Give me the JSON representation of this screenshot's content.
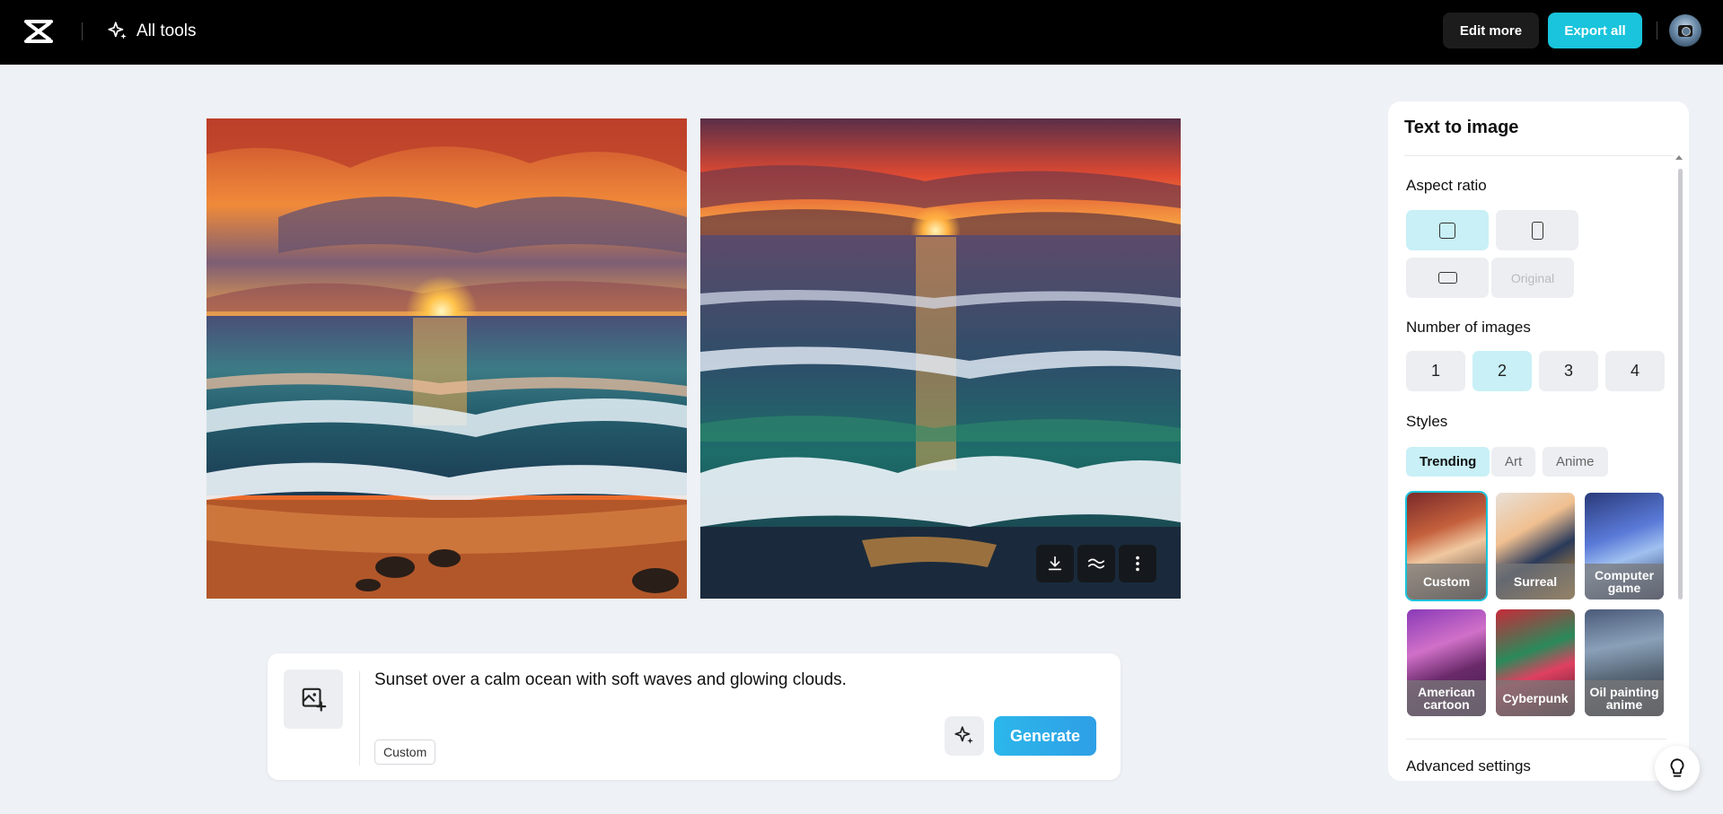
{
  "header": {
    "logo": "capcut-logo",
    "all_tools_label": "All tools",
    "edit_more_label": "Edit more",
    "export_all_label": "Export all"
  },
  "images": [
    {
      "subject": "Sunset over ocean with waves on rocky beach"
    },
    {
      "subject": "Sunset over ocean with breaking waves"
    }
  ],
  "image_toolbar": {
    "icons": [
      "download-icon",
      "upscale-icon",
      "more-icon"
    ]
  },
  "prompt": {
    "text": "Sunset over a calm ocean with soft waves and glowing clouds.",
    "style_chip": "Custom",
    "generate_label": "Generate"
  },
  "panel": {
    "title": "Text to image",
    "aspect_ratio_label": "Aspect ratio",
    "aspect_options": [
      "square",
      "portrait",
      "landscape"
    ],
    "original_label": "Original",
    "number_label": "Number of images",
    "numbers": [
      "1",
      "2",
      "3",
      "4"
    ],
    "selected_number": "2",
    "styles_label": "Styles",
    "style_tabs": [
      "Trending",
      "Art",
      "Anime"
    ],
    "style_cards": [
      "Custom",
      "Surreal",
      "Computer game",
      "American cartoon",
      "Cyberpunk",
      "Oil painting anime"
    ],
    "advanced_label": "Advanced settings"
  },
  "colors": {
    "accent": "#19c4dc",
    "selected_bg": "#c8f0f6"
  }
}
